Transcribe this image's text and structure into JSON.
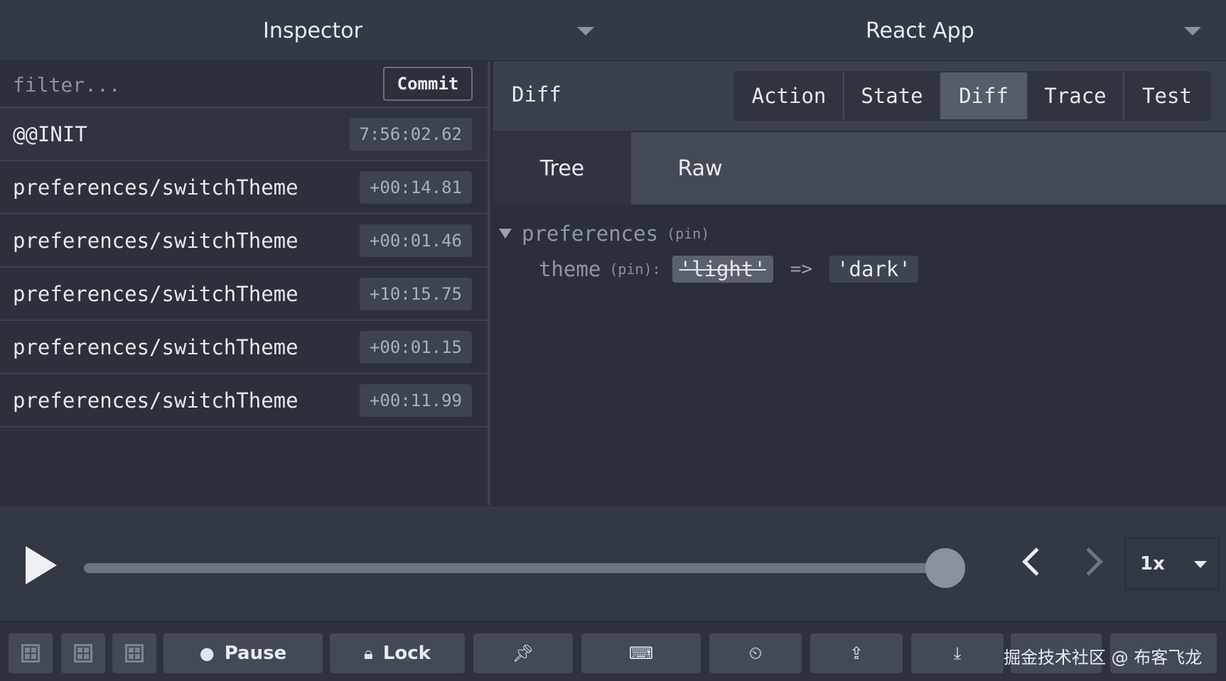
{
  "header": {
    "left_selector": "Inspector",
    "right_selector": "React App"
  },
  "actions_panel": {
    "filter_placeholder": "filter...",
    "commit_label": "Commit",
    "actions": [
      {
        "name": "@@INIT",
        "time": "7:56:02.62"
      },
      {
        "name": "preferences/switchTheme",
        "time": "+00:14.81"
      },
      {
        "name": "preferences/switchTheme",
        "time": "+00:01.46"
      },
      {
        "name": "preferences/switchTheme",
        "time": "+10:15.75"
      },
      {
        "name": "preferences/switchTheme",
        "time": "+00:01.15"
      },
      {
        "name": "preferences/switchTheme",
        "time": "+00:11.99"
      }
    ]
  },
  "monitor": {
    "title": "Diff",
    "tabs": [
      "Action",
      "State",
      "Diff",
      "Trace",
      "Test"
    ],
    "active_tab": "Diff",
    "subtabs": [
      "Tree",
      "Raw"
    ],
    "active_subtab": "Tree",
    "diff": {
      "node_key": "preferences",
      "node_pin": "(pin)",
      "leaf_key": "theme",
      "leaf_pin": "(pin):",
      "old_value": "'light'",
      "arrow": "=>",
      "new_value": "'dark'"
    }
  },
  "slider": {
    "position_fraction": 1.0,
    "speed": "1x"
  },
  "toolbar": {
    "pause_label": "Pause",
    "lock_label": "Lock",
    "watermark": "掘金技术社区 @ 布客飞龙"
  }
}
